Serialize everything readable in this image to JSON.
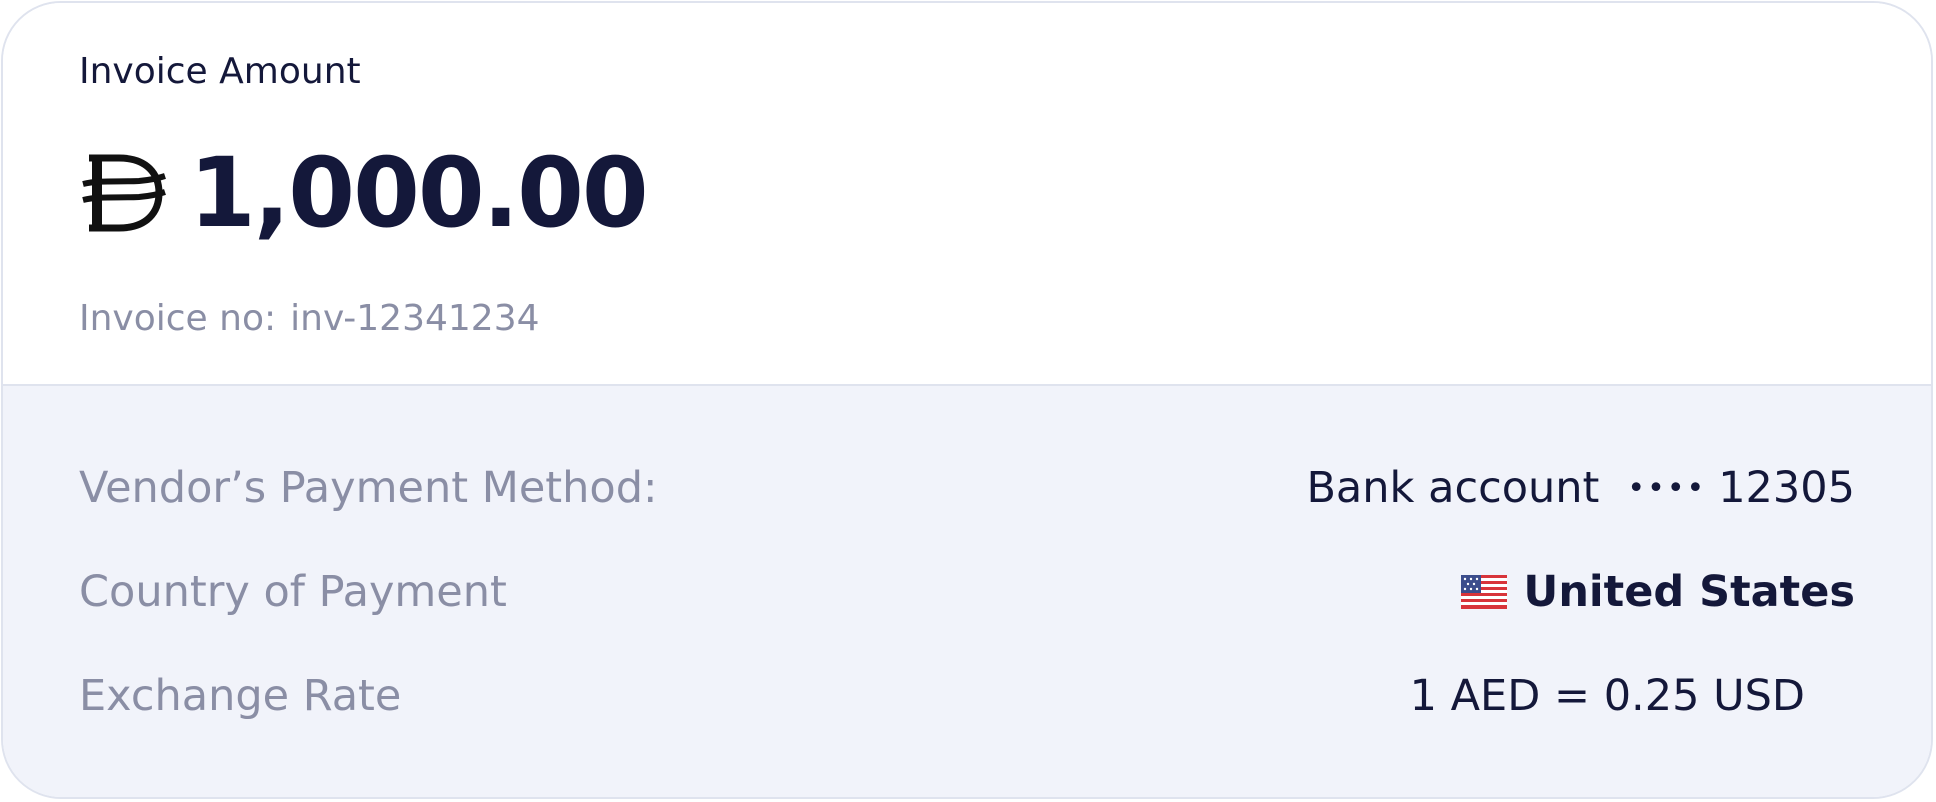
{
  "invoice": {
    "title": "Invoice Amount",
    "currency_icon": "dirham-currency-icon",
    "amount": "1,000.00",
    "number_label": "Invoice no:",
    "number_value": "inv-12341234"
  },
  "details": {
    "payment_method": {
      "label": "Vendor’s Payment Method:",
      "value": "Bank account",
      "mask": "••••",
      "last_digits": "12305"
    },
    "country": {
      "label": "Country of Payment",
      "flag_icon": "us-flag-icon",
      "value": "United States"
    },
    "exchange_rate": {
      "label": "Exchange Rate",
      "value": "1 AED = 0.25 USD"
    }
  },
  "colors": {
    "primary_text": "#14183a",
    "muted_text": "#8a8ea5",
    "panel_background": "#f1f3fa",
    "border": "#dfe3ee"
  }
}
